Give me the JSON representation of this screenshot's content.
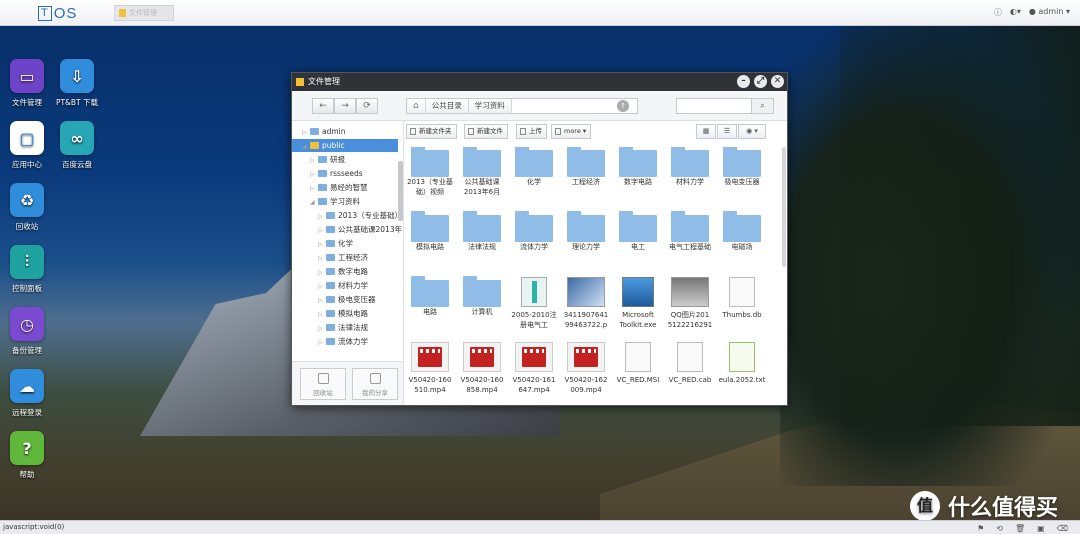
{
  "topbar": {
    "logo_t": "T",
    "logo_rest": "OS",
    "task_label": "文件管理",
    "info_icon": "ⓘ",
    "globe_icon": "◐",
    "user_icon": "●",
    "user": "admin",
    "caret": "▾"
  },
  "desktop_icons": [
    {
      "label": "文件管理",
      "color": "#6d43c8",
      "glyph": "▭"
    },
    {
      "label": "PT&BT 下载",
      "color": "#2f8ddb",
      "glyph": "⇩"
    },
    {
      "label": "应用中心",
      "color": "#ffffff",
      "glyph": "▢"
    },
    {
      "label": "百度云盘",
      "color": "#27a7b5",
      "glyph": "∞"
    },
    {
      "label": "回收站",
      "color": "#2f8ddb",
      "glyph": "♻"
    },
    {
      "label": "控制面板",
      "color": "#1fa3a0",
      "glyph": "⫶"
    },
    {
      "label": "备份管理",
      "color": "#7a4bd0",
      "glyph": "◷"
    },
    {
      "label": "远程登录",
      "color": "#2f8ddb",
      "glyph": "☁"
    },
    {
      "label": "帮助",
      "color": "#5fb83a",
      "glyph": "?"
    }
  ],
  "window": {
    "title": "文件管理",
    "btn_min": "–",
    "btn_max": "⤢",
    "btn_close": "✕",
    "nav_back": "←",
    "nav_forward": "→",
    "nav_refresh": "⟳",
    "crumb_home": "⌂",
    "crumbs": [
      "公共目录",
      "学习资料"
    ],
    "go": "↑",
    "search_icon": "⌕",
    "toolbar": {
      "new_folder": "新建文件夹",
      "new_file": "新建文件",
      "upload": "上传",
      "more": "more ▾"
    },
    "views": [
      "▦",
      "☰",
      "◉ ▾"
    ],
    "tree": [
      {
        "label": "admin",
        "level": 0,
        "arrow": "▷",
        "type": "user"
      },
      {
        "label": "public",
        "level": 0,
        "arrow": "◢",
        "type": "user",
        "selected": true
      },
      {
        "label": "研报",
        "level": 1,
        "arrow": "▷"
      },
      {
        "label": "rssseeds",
        "level": 1,
        "arrow": "▷"
      },
      {
        "label": "易经的智慧",
        "level": 1,
        "arrow": "▷"
      },
      {
        "label": "学习资料",
        "level": 1,
        "arrow": "◢"
      },
      {
        "label": "2013（专业基础）",
        "level": 2,
        "arrow": "▷"
      },
      {
        "label": "公共基础课2013年",
        "level": 2,
        "arrow": "▷"
      },
      {
        "label": "化学",
        "level": 2,
        "arrow": "▷"
      },
      {
        "label": "工程经济",
        "level": 2,
        "arrow": "▷"
      },
      {
        "label": "数字电路",
        "level": 2,
        "arrow": "▷"
      },
      {
        "label": "材料力学",
        "level": 2,
        "arrow": "▷"
      },
      {
        "label": "极电变压器",
        "level": 2,
        "arrow": "▷"
      },
      {
        "label": "模拟电路",
        "level": 2,
        "arrow": "▷"
      },
      {
        "label": "法律法规",
        "level": 2,
        "arrow": "▷"
      },
      {
        "label": "流体力学",
        "level": 2,
        "arrow": "▷"
      }
    ],
    "bottom_buttons": [
      "回收站",
      "我的分享"
    ],
    "files": [
      {
        "name": "2013（专业基础）视频",
        "type": "folder"
      },
      {
        "name": "公共基础课2013年6月",
        "type": "folder"
      },
      {
        "name": "化学",
        "type": "folder"
      },
      {
        "name": "工程经济",
        "type": "folder"
      },
      {
        "name": "数字电路",
        "type": "folder"
      },
      {
        "name": "材料力学",
        "type": "folder"
      },
      {
        "name": "极电变压器",
        "type": "folder"
      },
      {
        "name": "模拟电路",
        "type": "folder"
      },
      {
        "name": "法律法规",
        "type": "folder"
      },
      {
        "name": "流体力学",
        "type": "folder"
      },
      {
        "name": "理论力学",
        "type": "folder"
      },
      {
        "name": "电工",
        "type": "folder"
      },
      {
        "name": "电气工程基础",
        "type": "folder"
      },
      {
        "name": "电磁场",
        "type": "folder"
      },
      {
        "name": "电路",
        "type": "folder"
      },
      {
        "name": "计算机",
        "type": "folder"
      },
      {
        "name": "2005-2010注册电气工",
        "type": "app"
      },
      {
        "name": "3411907641 99463722.p",
        "type": "img"
      },
      {
        "name": "Microsoft Toolkit.exe",
        "type": "exe"
      },
      {
        "name": "QQ图片201 5122216291",
        "type": "img2"
      },
      {
        "name": "Thumbs.db",
        "type": "doc"
      },
      {
        "name": "V50420-160 510.mp4",
        "type": "video"
      },
      {
        "name": "V50420-160 858.mp4",
        "type": "video"
      },
      {
        "name": "V50420-161 647.mp4",
        "type": "video"
      },
      {
        "name": "V50420-162 009.mp4",
        "type": "video"
      },
      {
        "name": "VC_RED.MSI",
        "type": "doc"
      },
      {
        "name": "VC_RED.cab",
        "type": "doc"
      },
      {
        "name": "eula.2052.txt",
        "type": "txt"
      }
    ]
  },
  "statusbar": {
    "text": "javascript:void(0)",
    "icons": [
      "⚑",
      "⟲",
      "🗑",
      "▣",
      "⌫"
    ]
  },
  "watermark": {
    "circle": "值",
    "text": "什么值得买"
  }
}
